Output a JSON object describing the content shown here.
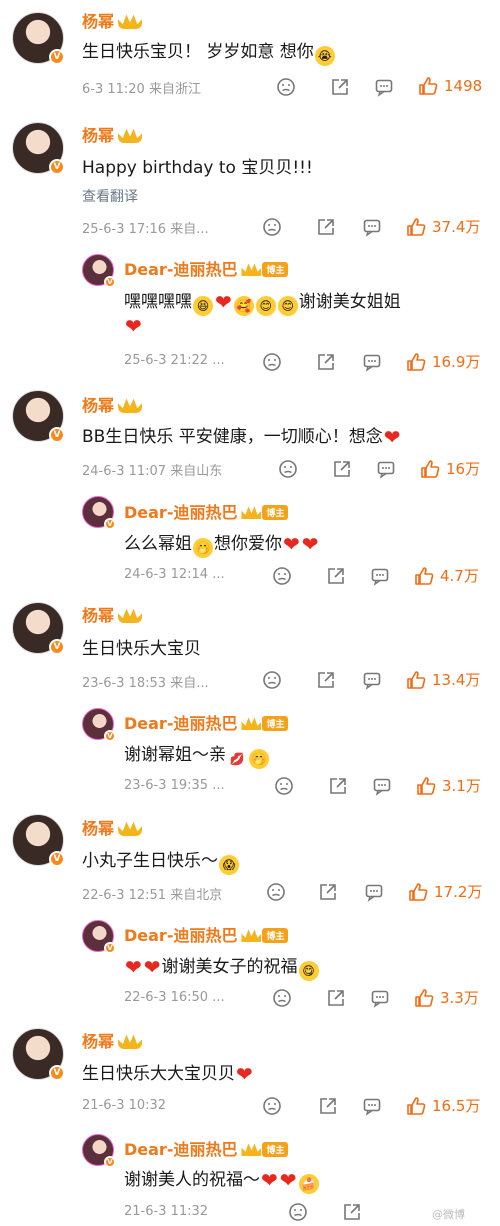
{
  "users": {
    "yangmi": "杨幂",
    "dilraba": "Dear-迪丽热巴",
    "boss_badge": "博主"
  },
  "comments": [
    {
      "text": "生日快乐宝贝！ 岁岁如意 想你",
      "meta": "6-3 11:20 来自浙江",
      "likes": "1498"
    },
    {
      "text": "Happy birthday to 宝贝贝!!!",
      "translate": "查看翻译",
      "meta": "25-6-3 17:16 来自...",
      "likes": "37.4万",
      "reply": {
        "text": "嘿嘿嘿嘿",
        "text2": "谢谢美女姐姐",
        "meta": "25-6-3 21:22 ...",
        "likes": "16.9万"
      }
    },
    {
      "text": "BB生日快乐 平安健康，一切顺心！想念",
      "meta": "24-6-3 11:07 来自山东",
      "likes": "16万",
      "reply": {
        "text": "么么幂姐",
        "text2": "想你爱你",
        "meta": "24-6-3 12:14 ...",
        "likes": "4.7万"
      }
    },
    {
      "text": "生日快乐大宝贝",
      "meta": "23-6-3 18:53 来自...",
      "likes": "13.4万",
      "reply": {
        "text": "谢谢幂姐～亲",
        "meta": "23-6-3 19:35 ...",
        "likes": "3.1万"
      }
    },
    {
      "text": "小丸子生日快乐～",
      "meta": "22-6-3 12:51 来自北京",
      "likes": "17.2万",
      "reply": {
        "text": "谢谢美女子的祝福",
        "meta": "22-6-3 16:50 ...",
        "likes": "3.3万"
      }
    },
    {
      "text": "生日快乐大大宝贝贝",
      "meta": "21-6-3 10:32",
      "likes": "16.5万",
      "reply": {
        "text": "谢谢美人的祝福～",
        "meta": "21-6-3 11:32",
        "likes": ""
      }
    }
  ],
  "icons": [
    "frown-icon",
    "share-icon",
    "comment-icon",
    "thumb-up-icon"
  ],
  "colors": {
    "accent": "#f0791a",
    "like": "#f26c13",
    "heart": "#e8271f"
  },
  "watermark": "@微博"
}
